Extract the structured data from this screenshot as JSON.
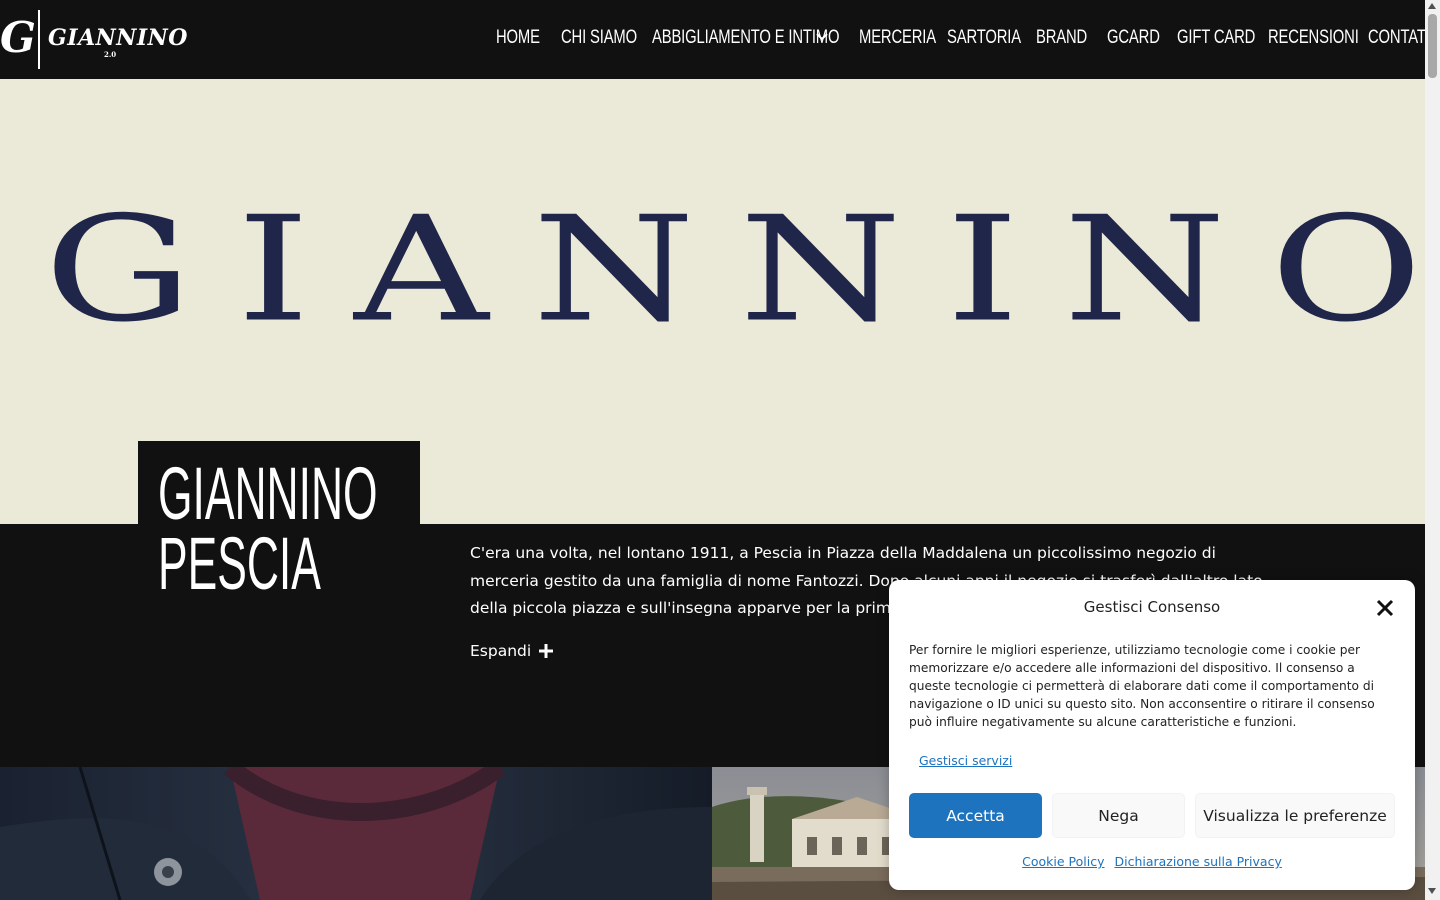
{
  "header": {
    "logo": {
      "mark": "G",
      "word": "GIANNINO",
      "version": "2.0"
    },
    "nav": [
      {
        "label": "HOME",
        "id": "home"
      },
      {
        "label": "CHI SIAMO",
        "id": "chi-siamo"
      },
      {
        "label": "ABBIGLIAMENTO E INTIMO",
        "id": "abbigliamento-e-intimo",
        "has_dropdown": true
      },
      {
        "label": "MERCERIA",
        "id": "merceria"
      },
      {
        "label": "SARTORIA",
        "id": "sartoria"
      },
      {
        "label": "BRAND",
        "id": "brand"
      },
      {
        "label": "GCARD",
        "id": "gcard"
      },
      {
        "label": "GIFT CARD",
        "id": "gift-card"
      },
      {
        "label": "RECENSIONI",
        "id": "recensioni"
      },
      {
        "label": "CONTATTI",
        "id": "contatti"
      }
    ]
  },
  "hero": {
    "wordmark": "GIANNINO"
  },
  "intro": {
    "title_line1": "GIANNINO",
    "title_line2": "PESCIA",
    "text": "C'era una volta, nel lontano 1911, a Pescia in Piazza della Maddalena un piccolissimo negozio di merceria gestito da una famiglia di nome Fantozzi. Dopo alcuni anni il negozio si trasferì dall'altro lato della piccola piazza e sull'insegna apparve per la prima volta il nome",
    "expand_label": "Espandi",
    "expand_icon": "plus-icon"
  },
  "consent": {
    "title": "Gestisci Consenso",
    "message": "Per fornire le migliori esperienze, utilizziamo tecnologie come i cookie per memorizzare e/o accedere alle informazioni del dispositivo. Il consenso a queste tecnologie ci permetterà di elaborare dati come il comportamento di navigazione o ID unici su questo sito. Non acconsentire o ritirare il consenso può influire negativamente su alcune caratteristiche e funzioni.",
    "manage_services": "Gestisci servizi",
    "accept": "Accetta",
    "deny": "Nega",
    "preferences": "Visualizza le preferenze",
    "cookie_policy": "Cookie Policy",
    "privacy": "Dichiarazione sulla Privacy"
  },
  "colors": {
    "header_bg": "#111111",
    "hero_bg": "#ebe9d8",
    "wordmark": "#20264a",
    "accent": "#1e73be"
  }
}
